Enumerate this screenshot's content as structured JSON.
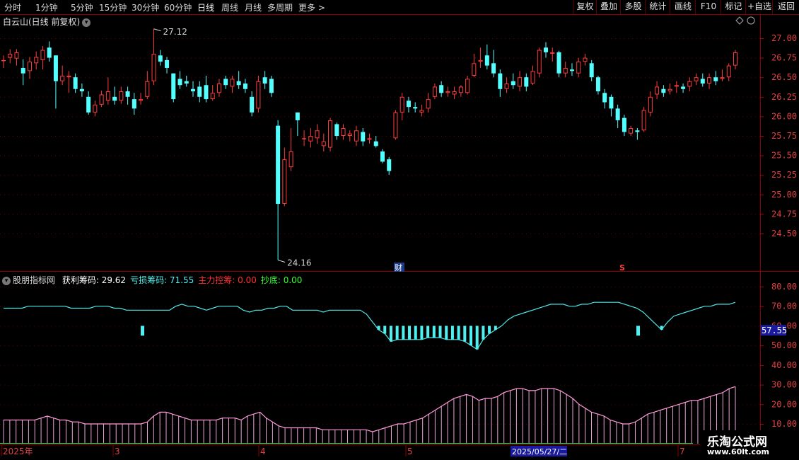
{
  "toolbar": {
    "periods": [
      "分时",
      "1分钟",
      "5分钟",
      "15分钟",
      "30分钟",
      "60分钟",
      "日线",
      "周线",
      "月线",
      "多周期",
      "更多"
    ],
    "active_period": "日线",
    "more_arrow": ">",
    "right_buttons": [
      "复权",
      "叠加",
      "多股",
      "统计",
      "画线",
      "F10",
      "标记",
      "+自选",
      "返回"
    ]
  },
  "stock": {
    "title": "白云山(日线 前复权)",
    "high_label": "27.12",
    "low_label": "24.16",
    "price_ticks": [
      "27.00",
      "26.75",
      "26.50",
      "26.25",
      "26.00",
      "25.75",
      "25.50",
      "25.25",
      "25.00",
      "24.75",
      "24.50"
    ],
    "marker_cai": "财",
    "marker_s": "S"
  },
  "indicator": {
    "name": "股朋指标网",
    "items": [
      {
        "label": "获利筹码: ",
        "value": "29.62",
        "color": "#ffffff"
      },
      {
        "label": "亏损筹码: ",
        "value": "71.55",
        "color": "#4ef0f0"
      },
      {
        "label": "主力控筹: ",
        "value": "0.00",
        "color": "#ff3030"
      },
      {
        "label": "抄底: ",
        "value": "0.00",
        "color": "#30ff30"
      }
    ],
    "ticks": [
      "80.00",
      "70.00",
      "60.00",
      "50.00",
      "40.00",
      "30.00",
      "20.00",
      "10.00"
    ],
    "current_value": "57.55"
  },
  "time_axis": {
    "labels": [
      "2025年",
      "3",
      "4",
      "5",
      "7"
    ],
    "cursor_date": "2025/05/27/二"
  },
  "watermark": {
    "name": "乐淘公式网",
    "url": "www.60lt.com"
  },
  "chart_data": {
    "type": "candlestick",
    "price_range": [
      24.16,
      27.12
    ],
    "candles": [
      [
        26.72,
        26.72,
        26.78,
        26.62
      ],
      [
        26.75,
        26.8,
        26.86,
        26.68
      ],
      [
        26.74,
        26.82,
        26.86,
        26.65
      ],
      [
        26.62,
        26.55,
        26.73,
        26.4
      ],
      [
        26.58,
        26.7,
        26.76,
        26.48
      ],
      [
        26.68,
        26.76,
        26.83,
        26.6
      ],
      [
        26.72,
        26.85,
        26.9,
        26.6
      ],
      [
        26.88,
        26.75,
        26.96,
        26.7
      ],
      [
        26.78,
        26.45,
        26.78,
        26.1
      ],
      [
        26.45,
        26.52,
        26.65,
        26.4
      ],
      [
        26.5,
        26.52,
        26.58,
        26.3
      ],
      [
        26.5,
        26.35,
        26.55,
        26.3
      ],
      [
        26.35,
        26.32,
        26.42,
        26.25
      ],
      [
        26.25,
        26.05,
        26.32,
        26.02
      ],
      [
        26.05,
        26.15,
        26.2,
        26.0
      ],
      [
        26.15,
        26.28,
        26.33,
        26.12
      ],
      [
        26.2,
        26.32,
        26.5,
        26.15
      ],
      [
        26.25,
        26.2,
        26.38,
        26.15
      ],
      [
        26.2,
        26.32,
        26.38,
        26.16
      ],
      [
        26.32,
        26.25,
        26.38,
        26.15
      ],
      [
        26.22,
        26.1,
        26.3,
        26.02
      ],
      [
        26.2,
        26.22,
        26.3,
        26.15
      ],
      [
        26.25,
        26.45,
        26.58,
        26.22
      ],
      [
        26.45,
        26.8,
        27.12,
        26.4
      ],
      [
        26.78,
        26.7,
        26.85,
        26.65
      ],
      [
        26.72,
        26.62,
        26.76,
        26.55
      ],
      [
        26.55,
        26.22,
        26.55,
        26.18
      ],
      [
        26.48,
        26.4,
        26.58,
        26.35
      ],
      [
        26.45,
        26.42,
        26.52,
        26.38
      ],
      [
        26.35,
        26.32,
        26.45,
        26.25
      ],
      [
        26.38,
        26.25,
        26.45,
        26.18
      ],
      [
        26.4,
        26.22,
        26.52,
        26.18
      ],
      [
        26.22,
        26.3,
        26.4,
        26.2
      ],
      [
        26.3,
        26.42,
        26.48,
        26.25
      ],
      [
        26.48,
        26.4,
        26.52,
        26.35
      ],
      [
        26.38,
        26.48,
        26.52,
        26.3
      ],
      [
        26.45,
        26.4,
        26.58,
        26.35
      ],
      [
        26.42,
        26.35,
        26.48,
        26.3
      ],
      [
        26.25,
        26.05,
        26.32,
        26.0
      ],
      [
        26.1,
        26.45,
        26.52,
        26.05
      ],
      [
        26.5,
        26.42,
        26.58,
        26.35
      ],
      [
        26.48,
        26.3,
        26.52,
        26.25
      ],
      [
        25.88,
        24.88,
        25.95,
        24.16
      ],
      [
        24.88,
        25.45,
        25.6,
        24.85
      ],
      [
        25.35,
        25.55,
        25.85,
        25.3
      ],
      [
        26.05,
        25.95,
        26.05,
        25.75
      ],
      [
        25.72,
        25.72,
        25.82,
        25.62
      ],
      [
        25.68,
        25.75,
        25.85,
        25.6
      ],
      [
        25.72,
        25.82,
        25.9,
        25.65
      ],
      [
        25.62,
        25.68,
        25.78,
        25.55
      ],
      [
        25.6,
        25.95,
        25.98,
        25.55
      ],
      [
        25.9,
        25.75,
        25.92,
        25.7
      ],
      [
        25.75,
        25.85,
        25.9,
        25.7
      ],
      [
        25.75,
        25.78,
        25.82,
        25.68
      ],
      [
        25.68,
        25.82,
        25.88,
        25.62
      ],
      [
        25.8,
        25.68,
        25.85,
        25.62
      ],
      [
        25.7,
        25.72,
        25.78,
        25.65
      ],
      [
        25.68,
        25.62,
        25.75,
        25.6
      ],
      [
        25.55,
        25.42,
        25.58,
        25.4
      ],
      [
        25.45,
        25.3,
        25.48,
        25.25
      ],
      [
        25.72,
        26.05,
        26.08,
        25.7
      ],
      [
        26.05,
        26.25,
        26.3,
        25.95
      ],
      [
        26.2,
        26.12,
        26.25,
        26.05
      ],
      [
        26.12,
        26.1,
        26.18,
        26.05
      ],
      [
        26.05,
        26.08,
        26.15,
        26.0
      ],
      [
        26.1,
        26.22,
        26.3,
        26.05
      ],
      [
        26.25,
        26.38,
        26.42,
        26.22
      ],
      [
        26.4,
        26.3,
        26.45,
        26.25
      ],
      [
        26.3,
        26.32,
        26.38,
        26.25
      ],
      [
        26.28,
        26.32,
        26.38,
        26.22
      ],
      [
        26.3,
        26.38,
        26.4,
        26.25
      ],
      [
        26.3,
        26.48,
        26.52,
        26.28
      ],
      [
        26.52,
        26.68,
        26.8,
        26.5
      ],
      [
        26.7,
        26.72,
        26.88,
        26.62
      ],
      [
        26.78,
        26.65,
        26.92,
        26.6
      ],
      [
        26.68,
        26.55,
        26.85,
        26.5
      ],
      [
        26.55,
        26.35,
        26.6,
        26.25
      ],
      [
        26.35,
        26.42,
        26.5,
        26.3
      ],
      [
        26.45,
        26.4,
        26.55,
        26.35
      ],
      [
        26.38,
        26.5,
        26.58,
        26.32
      ],
      [
        26.5,
        26.38,
        26.55,
        26.32
      ],
      [
        26.42,
        26.58,
        26.65,
        26.4
      ],
      [
        26.55,
        26.85,
        26.88,
        26.5
      ],
      [
        26.88,
        26.82,
        26.95,
        26.75
      ],
      [
        26.8,
        26.82,
        26.88,
        26.7
      ],
      [
        26.82,
        26.55,
        26.84,
        26.5
      ],
      [
        26.55,
        26.62,
        26.7,
        26.5
      ],
      [
        26.6,
        26.58,
        26.68,
        26.52
      ],
      [
        26.55,
        26.7,
        26.75,
        26.5
      ],
      [
        26.7,
        26.75,
        26.8,
        26.65
      ],
      [
        26.68,
        26.5,
        26.72,
        26.45
      ],
      [
        26.5,
        26.32,
        26.52,
        26.28
      ],
      [
        26.3,
        26.18,
        26.35,
        26.1
      ],
      [
        26.25,
        26.1,
        26.28,
        26.0
      ],
      [
        26.1,
        25.95,
        26.15,
        25.85
      ],
      [
        25.98,
        25.8,
        26.02,
        25.75
      ],
      [
        25.78,
        25.85,
        25.88,
        25.75
      ],
      [
        25.82,
        25.8,
        25.85,
        25.7
      ],
      [
        25.82,
        26.08,
        26.12,
        25.8
      ],
      [
        26.05,
        26.25,
        26.32,
        26.0
      ],
      [
        26.28,
        26.38,
        26.45,
        26.22
      ],
      [
        26.35,
        26.3,
        26.4,
        26.25
      ],
      [
        26.32,
        26.35,
        26.42,
        26.28
      ],
      [
        26.38,
        26.4,
        26.45,
        26.3
      ],
      [
        26.38,
        26.35,
        26.42,
        26.3
      ],
      [
        26.38,
        26.45,
        26.5,
        26.32
      ],
      [
        26.45,
        26.5,
        26.55,
        26.4
      ],
      [
        26.48,
        26.42,
        26.55,
        26.38
      ],
      [
        26.42,
        26.5,
        26.55,
        26.35
      ],
      [
        26.5,
        26.45,
        26.58,
        26.4
      ],
      [
        26.48,
        26.5,
        26.6,
        26.45
      ],
      [
        26.5,
        26.65,
        26.68,
        26.45
      ],
      [
        26.65,
        26.82,
        26.85,
        26.6
      ]
    ],
    "indicator_range": [
      10,
      85
    ],
    "loss_chips": [
      69,
      69,
      69,
      69,
      70,
      70,
      70,
      70,
      70,
      70,
      70,
      69,
      69,
      69,
      69,
      70,
      70,
      70,
      69,
      69,
      68,
      68,
      68,
      68,
      68,
      68,
      68,
      68,
      70,
      71,
      70,
      70,
      69,
      68,
      69,
      70,
      70,
      70,
      70,
      68,
      67,
      68,
      68,
      69,
      69,
      70,
      70,
      68,
      68,
      68,
      68,
      68,
      67,
      68,
      68,
      68,
      68,
      68,
      68,
      66,
      62,
      58,
      56,
      52,
      53,
      53,
      53,
      53,
      53,
      54,
      54,
      54,
      53,
      53,
      53,
      52,
      50,
      48,
      53,
      56,
      58,
      60,
      63,
      65,
      66,
      67,
      68,
      69,
      70,
      71,
      71,
      71,
      70,
      70,
      71,
      71,
      72,
      72,
      72,
      72,
      72,
      71,
      70,
      69,
      67,
      64,
      61,
      58,
      62,
      65,
      66,
      67,
      68,
      69,
      70,
      70,
      71,
      71,
      71,
      72
    ],
    "profit_chips": [
      12,
      12,
      12,
      12,
      12,
      12,
      13,
      14,
      13,
      12,
      12,
      11,
      11,
      10,
      10,
      10,
      10,
      10,
      10,
      10,
      10,
      10,
      10,
      11,
      14,
      16,
      16,
      15,
      14,
      13,
      12,
      12,
      12,
      12,
      12,
      13,
      13,
      13,
      12,
      14,
      15,
      16,
      13,
      11,
      9,
      8,
      8,
      8,
      8,
      8,
      8,
      7,
      7,
      7,
      7,
      7,
      7,
      7,
      7,
      6,
      7,
      8,
      9,
      10,
      10,
      11,
      12,
      13,
      15,
      17,
      19,
      21,
      23,
      24,
      25,
      24,
      22,
      23,
      23,
      24,
      26,
      27,
      28,
      28,
      27,
      27,
      28,
      28,
      28,
      27,
      25,
      23,
      20,
      18,
      16,
      15,
      14,
      12,
      11,
      10,
      10,
      11,
      13,
      15,
      16,
      17,
      18,
      19,
      20,
      21,
      22,
      22,
      23,
      24,
      25,
      26,
      28,
      29
    ],
    "volume_like_scale": "0-85"
  }
}
